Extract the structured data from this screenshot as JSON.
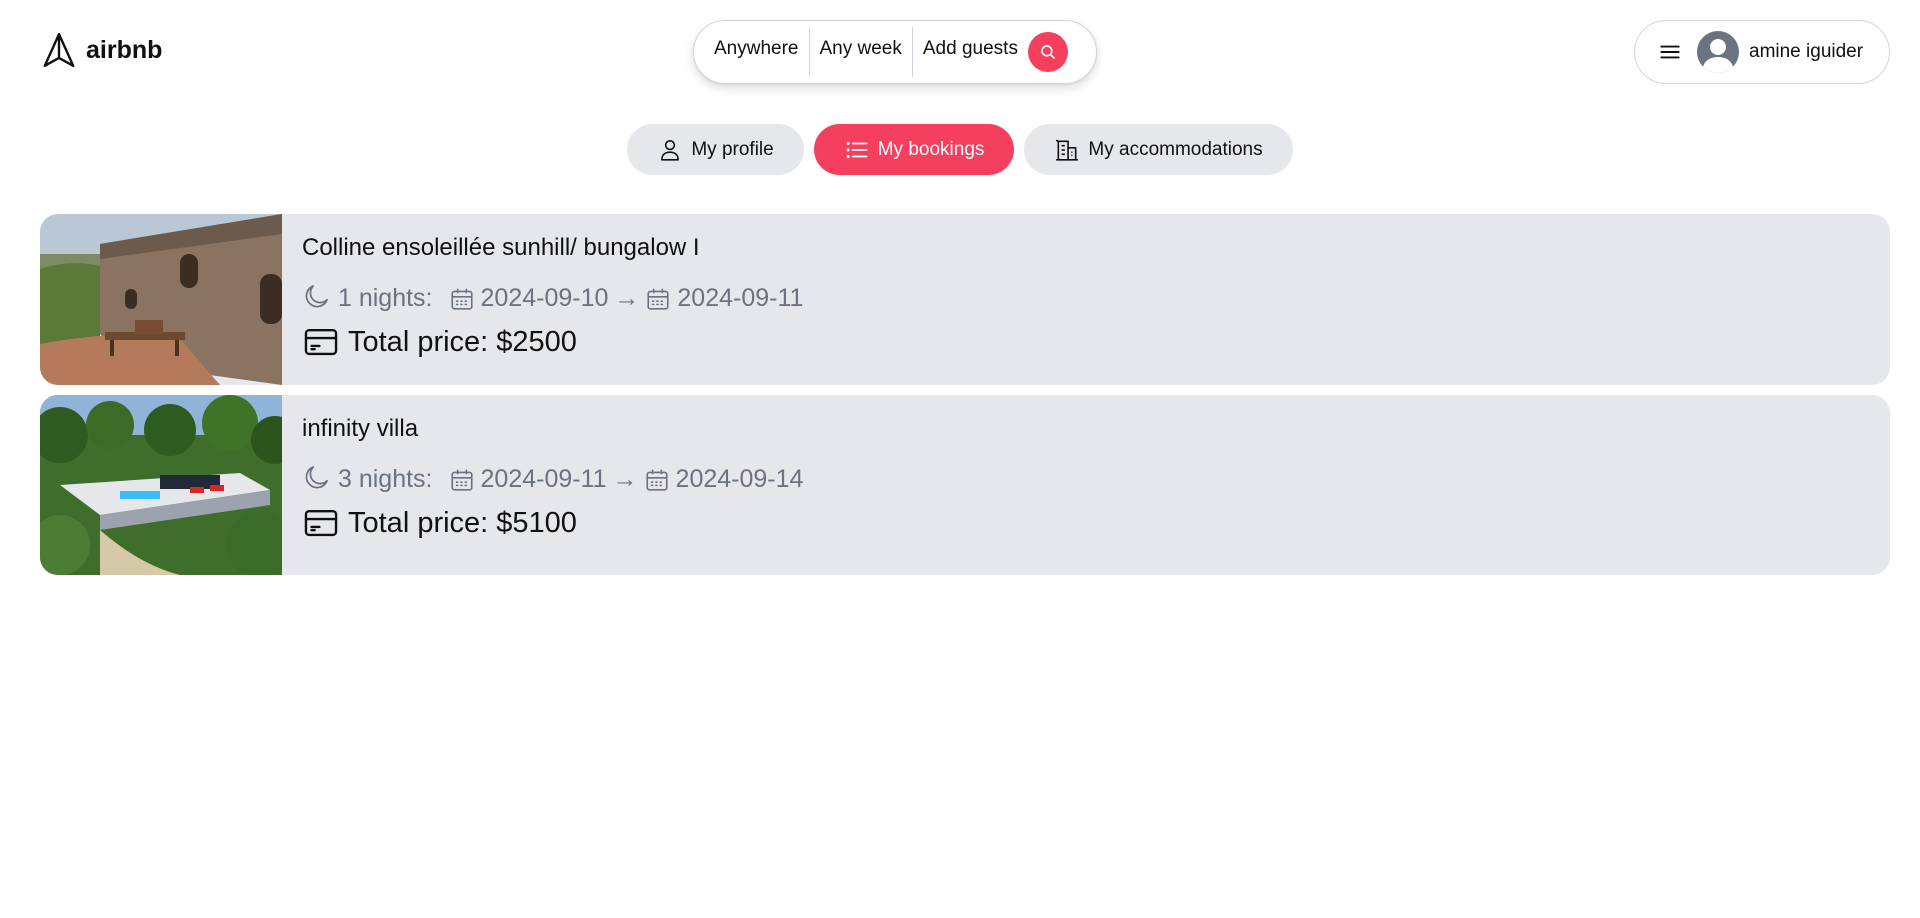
{
  "header": {
    "logo_text": "airbnb",
    "search": {
      "anywhere": "Anywhere",
      "any_week": "Any week",
      "add_guests": "Add guests"
    },
    "user": {
      "name": "amine iguider"
    }
  },
  "tabs": [
    {
      "label": "My profile",
      "icon": "person-icon",
      "active": false
    },
    {
      "label": "My bookings",
      "icon": "list-icon",
      "active": true
    },
    {
      "label": "My accommodations",
      "icon": "building-icon",
      "active": false
    }
  ],
  "bookings": [
    {
      "title": "Colline ensoleillée sunhill/ bungalow I",
      "nights": "1 nights:",
      "check_in": "2024-09-10",
      "arrow": "→",
      "check_out": "2024-09-11",
      "price": "Total price: $2500"
    },
    {
      "title": "infinity villa",
      "nights": "3 nights:",
      "check_in": "2024-09-11",
      "arrow": "→",
      "check_out": "2024-09-14",
      "price": "Total price: $5100"
    }
  ],
  "colors": {
    "brand": "#f43f5e",
    "card_bg": "#e5e7eb",
    "muted_text": "#6b7280"
  }
}
